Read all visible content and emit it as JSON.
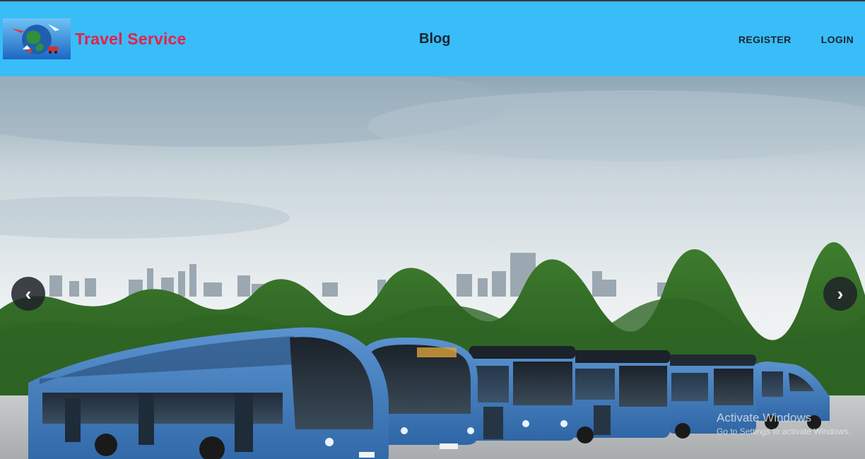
{
  "navbar": {
    "brand_name": "Travel Service",
    "logo_icon": "globe-travel-logo",
    "blog_label": "Blog",
    "register_label": "REGISTER",
    "login_label": "LOGIN",
    "background_color": "#38bdf8",
    "brand_color": "#e8204a"
  },
  "carousel": {
    "prev_symbol": "‹",
    "next_symbol": "›",
    "slide_subject": "city-buses-fleet"
  },
  "os_watermark": {
    "title": "Activate Windows",
    "subtitle": "Go to Settings to activate Windows."
  }
}
